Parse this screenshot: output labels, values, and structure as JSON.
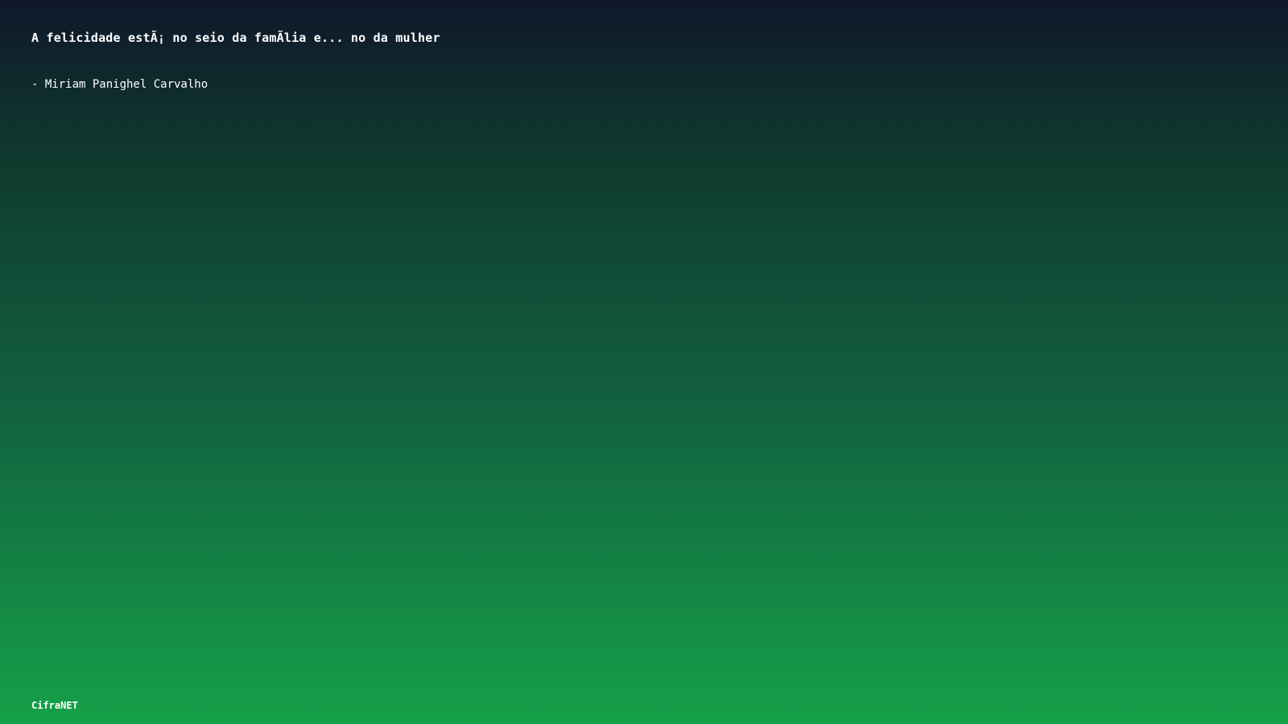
{
  "quote": {
    "text": "A felicidade estÃ¡ no seio da famÃ­lia e... no da mulher",
    "author": "- Miriam Panighel Carvalho"
  },
  "footer": {
    "brand": "CifraNET"
  },
  "colors": {
    "gradient_top": "#0f172a",
    "gradient_bottom": "#15a048",
    "text": "#ffffff"
  }
}
